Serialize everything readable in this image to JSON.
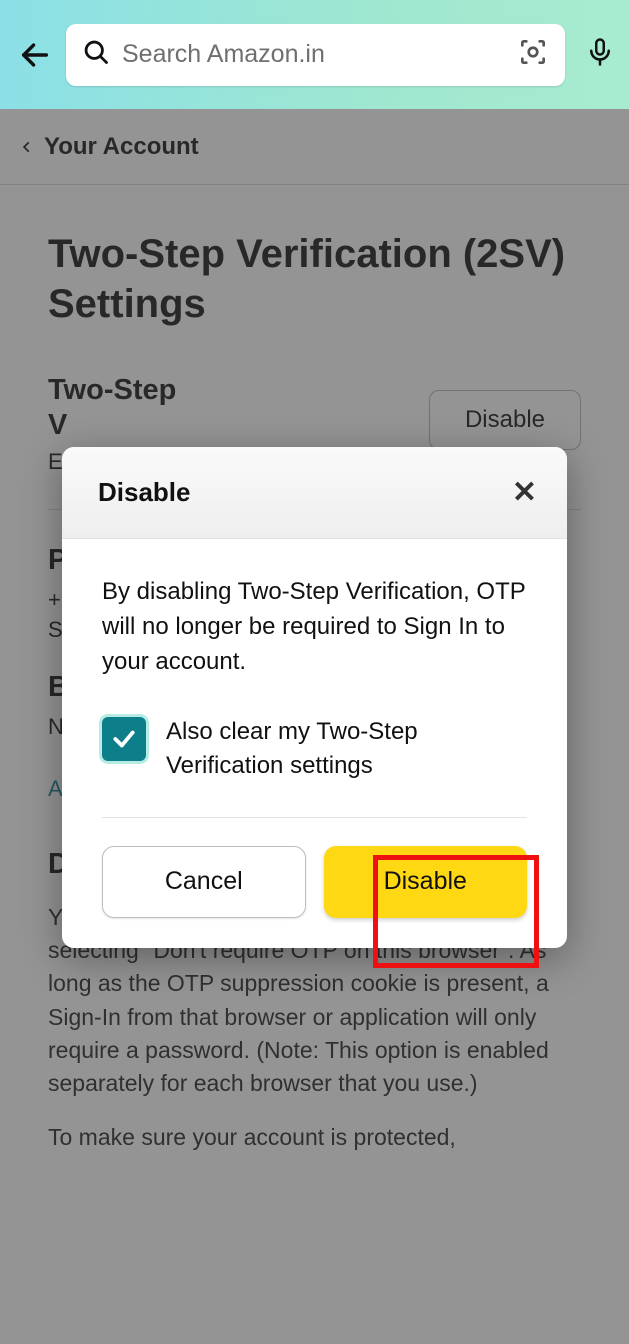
{
  "topbar": {
    "search_placeholder": "Search Amazon.in"
  },
  "breadcrumb": {
    "label": "Your Account"
  },
  "page": {
    "title": "Two-Step Verification (2SV) Settings"
  },
  "section": {
    "heading": "Two-Step Verification",
    "status_prefix": "E",
    "disable_button": "Disable"
  },
  "fields": {
    "p_label_prefix": "P",
    "phone_prefix": "+",
    "s_prefix": "S",
    "b_label_prefix": "B",
    "n_prefix": "N",
    "a_prefix": "A",
    "d_label_prefix": "D"
  },
  "body": {
    "paragraph1": "You may suppress future OTP challenges by selecting \"Don't require OTP on this browser\". As long as the OTP suppression cookie is present, a Sign-In from that browser or application will only require a password. (Note: This option is enabled separately for each browser that you use.)",
    "paragraph2": "To make sure your account is protected,"
  },
  "modal": {
    "title": "Disable",
    "message": "By disabling Two-Step Verification, OTP will no longer be required to Sign In to your account.",
    "checkbox_label": "Also clear my Two-Step Verification settings",
    "checkbox_checked": true,
    "cancel_label": "Cancel",
    "confirm_label": "Disable"
  }
}
